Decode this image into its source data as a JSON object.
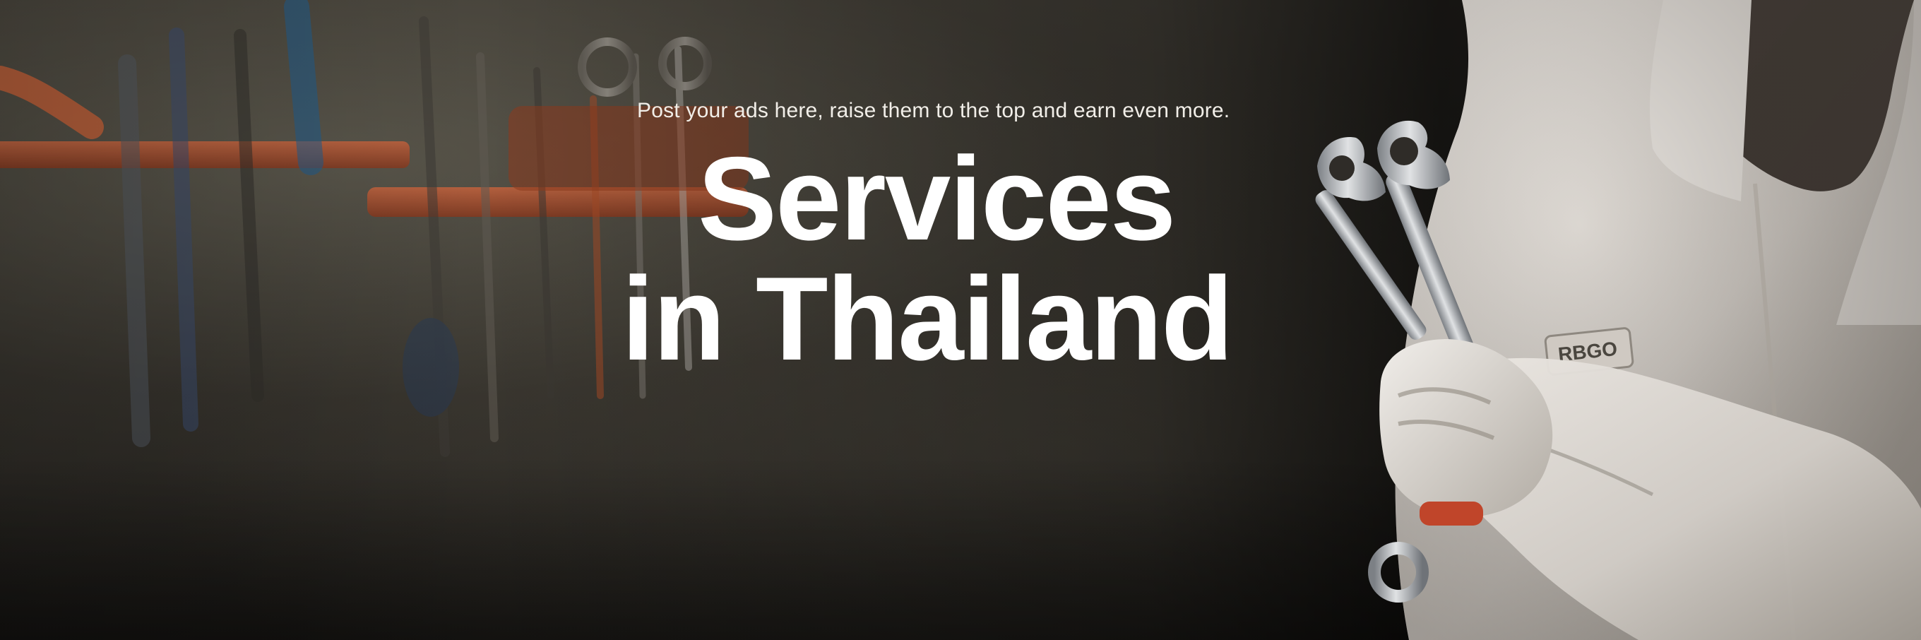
{
  "banner": {
    "tagline": "Post your ads here, raise them to the top and earn even more.",
    "title_line_1": "Services",
    "title_line_2": "in Thailand",
    "coverall_badge_text": "RBGO"
  },
  "colors": {
    "text": "#ffffff",
    "tool_rack": "#c8532f",
    "coverall": "#d8d4cf",
    "wrench": "#b9bcc0"
  },
  "icons": {
    "wrench_left": "wrench-icon",
    "wrench_right": "wrench-icon"
  }
}
